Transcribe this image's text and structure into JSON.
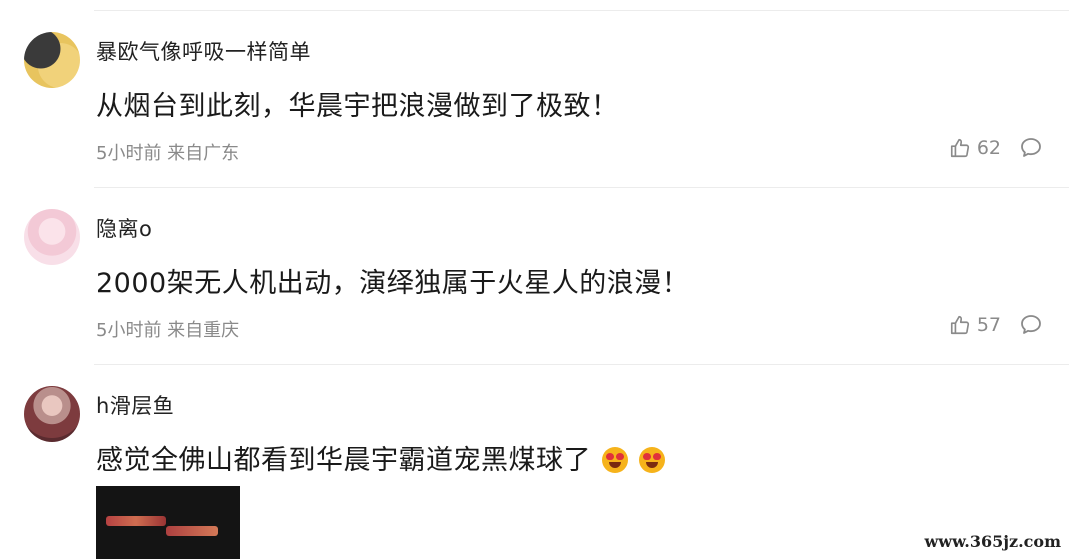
{
  "comments": [
    {
      "username": "暴欧气像呼吸一样简单",
      "text": "从烟台到此刻，华晨宇把浪漫做到了极致！",
      "meta": "5小时前 来自广东",
      "likes": "62"
    },
    {
      "username": "隐离o",
      "text": "2000架无人机出动，演绎独属于火星人的浪漫！",
      "meta": "5小时前 来自重庆",
      "likes": "57"
    },
    {
      "username": "h滑层鱼",
      "text": "感觉全佛山都看到华晨宇霸道宠黑煤球了"
    }
  ],
  "watermark": "www.365jz.com"
}
